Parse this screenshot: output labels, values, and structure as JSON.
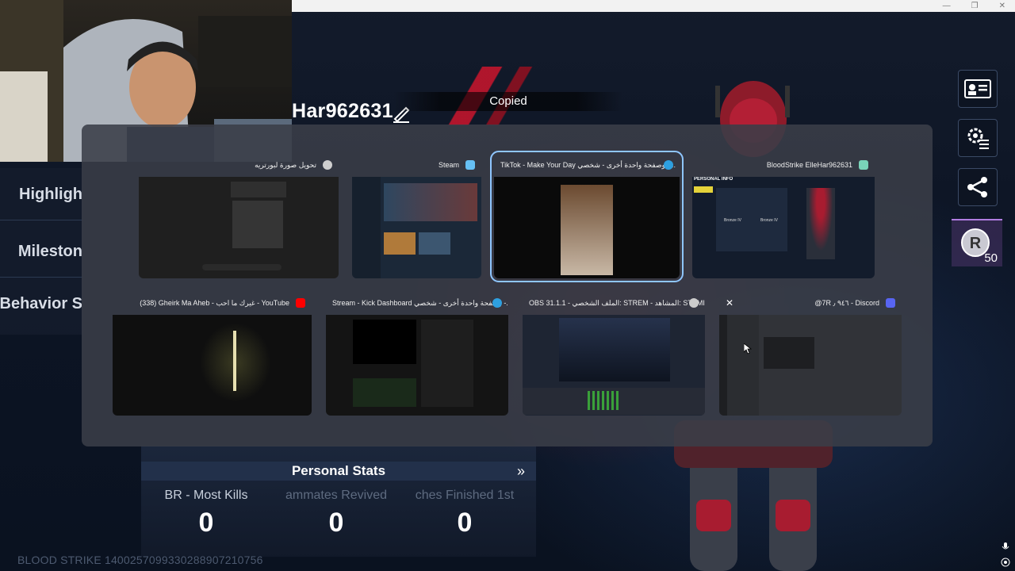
{
  "game": {
    "player_name": "Har962631",
    "toast": "Copied",
    "left_menu": [
      "Highligh",
      "Mileston",
      "Behavior S"
    ],
    "rank_level": "50",
    "stats_title": "Personal Stats",
    "stats": [
      {
        "label": "BR - Most Kills",
        "value": "0"
      },
      {
        "label": "ammates Revived",
        "value": "0"
      },
      {
        "label": "ches Finished 1st",
        "value": "0"
      }
    ],
    "footer_id": "BLOOD STRIKE 1400257099330288907210756"
  },
  "switcher": {
    "windows": [
      {
        "title": "تحويل صورة لبورتريه",
        "icon": "openai-icon",
        "color": "#cfcfcf"
      },
      {
        "title": "Steam",
        "icon": "steam-icon",
        "color": "#66c0f4"
      },
      {
        "title": "TikTok - Make Your Day وصفحة واحدة أخرى - شخصي -...",
        "icon": "edge-icon",
        "color": "#2ea0e0"
      },
      {
        "title": "BloodStrike ElleHar962631",
        "icon": "bloodstrike-icon",
        "color": "#79d3b9"
      },
      {
        "title": "(338) Gheirk Ma Aheb - غيرك ما احب - YouTube",
        "icon": "youtube-icon",
        "color": "#ff0000"
      },
      {
        "title": "Stream - Kick Dashboard وصفحة واحدة أخرى - شخصي -...",
        "icon": "edge-icon",
        "color": "#2ea0e0"
      },
      {
        "title": "OBS 31.1.1 - الملف الشخصي: STREM - المشاهد: STEMING",
        "icon": "obs-icon",
        "color": "#cccccc"
      },
      {
        "title": "@7R ٩٤٦ ٫ - Discord",
        "icon": "discord-icon",
        "color": "#5865f2"
      }
    ],
    "thumb_texts": {
      "personal_info": "PERSONAL INFO",
      "bronze_a": "Bronze IV",
      "bronze_b": "Bronze IV"
    }
  },
  "colors": {
    "accent_selected": "#8fc6ff",
    "brand_red": "#c1152c"
  }
}
